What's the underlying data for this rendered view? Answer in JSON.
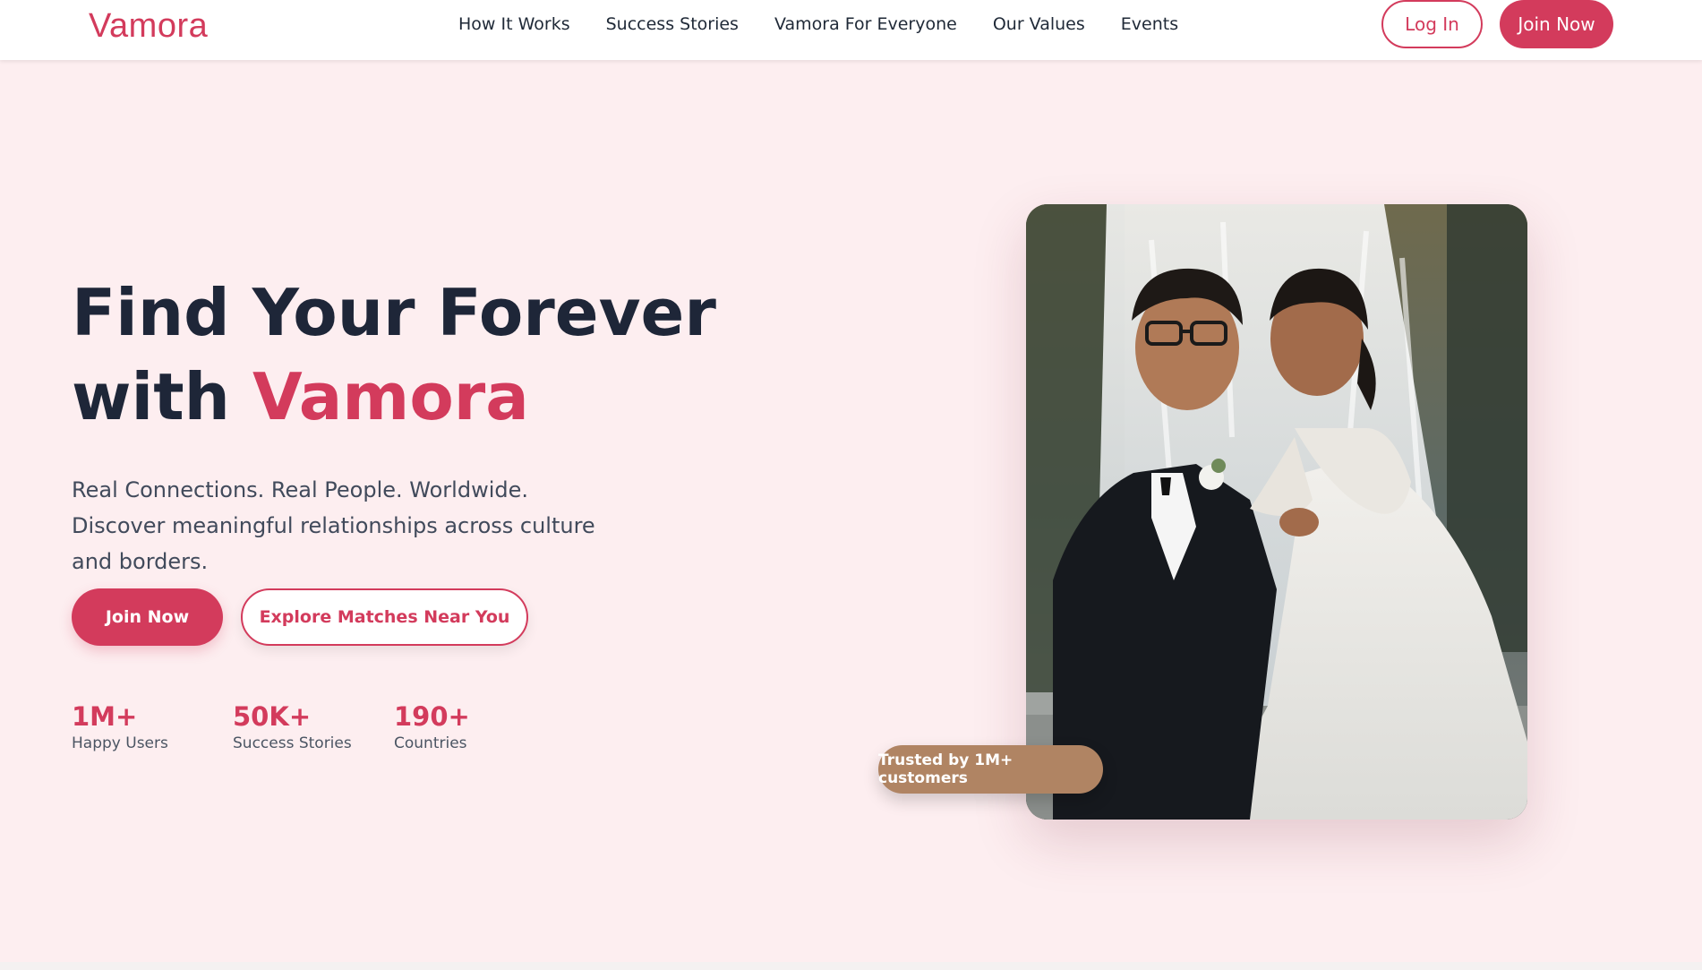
{
  "nav": {
    "logo": "Vamora",
    "links": [
      "How It Works",
      "Success Stories",
      "Vamora For Everyone",
      "Our Values",
      "Events"
    ],
    "login_label": "Log In",
    "join_label": "Join Now"
  },
  "hero": {
    "title_line1": "Find Your Forever",
    "title_line2_prefix": "with ",
    "title_line2_accent": "Vamora",
    "subtitle": "Real Connections. Real People. Worldwide. Discover meaningful relationships across culture and borders.",
    "join_label": "Join Now",
    "explore_label": "Explore Matches Near You",
    "stats": [
      {
        "value": "1M+",
        "label": "Happy Users"
      },
      {
        "value": "50K+",
        "label": "Success Stories"
      },
      {
        "value": "190+",
        "label": "Countries"
      }
    ],
    "badge": "Trusted by 1M+ customers"
  },
  "colors": {
    "brand": "#d33b5c",
    "background": "#fdeef0",
    "heading": "#1e2638",
    "badge": "#b08463"
  }
}
